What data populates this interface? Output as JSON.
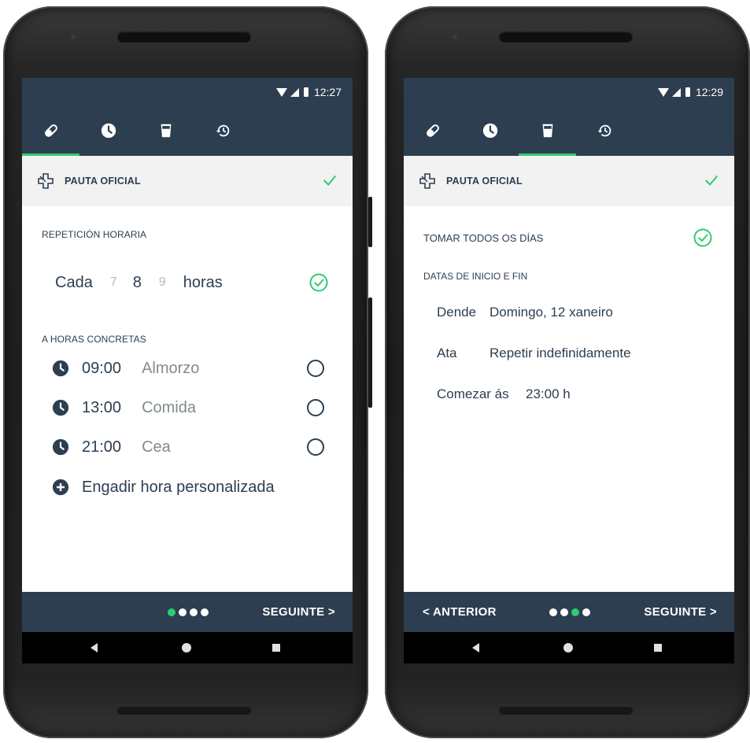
{
  "colors": {
    "primary": "#2c3e50",
    "accent": "#2ecc71",
    "muted": "#7f8c8d",
    "dim": "#b8b8b8",
    "panel": "#f2f2f2"
  },
  "screen1": {
    "status": {
      "time": "12:27"
    },
    "tabs": [
      {
        "icon": "pill-icon",
        "active": true
      },
      {
        "icon": "clock-icon",
        "active": false
      },
      {
        "icon": "glass-icon",
        "active": false
      },
      {
        "icon": "history-icon",
        "active": false
      }
    ],
    "pauta": {
      "label": "PAUTA OFICIAL",
      "icon": "medical-cross-icon",
      "checked": true
    },
    "repeticion": {
      "title": "REPETICIÓN HORARIA",
      "prefix": "Cada",
      "prev": "7",
      "value": "8",
      "next": "9",
      "suffix": "horas",
      "selected": true
    },
    "concretas": {
      "title": "A HORAS CONCRETAS",
      "items": [
        {
          "time": "09:00",
          "label": "Almorzo",
          "selected": false
        },
        {
          "time": "13:00",
          "label": "Comida",
          "selected": false
        },
        {
          "time": "21:00",
          "label": "Cea",
          "selected": false
        }
      ],
      "add_label": "Engadir hora personalizada"
    },
    "nav": {
      "next": "SEGUINTE >",
      "page_index": 0,
      "page_count": 4
    }
  },
  "screen2": {
    "status": {
      "time": "12:29"
    },
    "tabs": [
      {
        "icon": "pill-icon",
        "active": false
      },
      {
        "icon": "clock-icon",
        "active": false
      },
      {
        "icon": "glass-icon",
        "active": true
      },
      {
        "icon": "history-icon",
        "active": false
      }
    ],
    "pauta": {
      "label": "PAUTA OFICIAL",
      "icon": "medical-cross-icon",
      "checked": true
    },
    "tomar": {
      "label": "TOMAR TODOS OS DÍAS",
      "selected": true
    },
    "datas": {
      "title": "DATAS DE INICIO E FIN",
      "dende_label": "Dende",
      "dende_value": "Domingo, 12 xaneiro",
      "ata_label": "Ata",
      "ata_value": "Repetir indefinidamente",
      "comezar_label": "Comezar ás",
      "comezar_value": "23:00 h"
    },
    "nav": {
      "prev": "< ANTERIOR",
      "next": "SEGUINTE >",
      "page_index": 2,
      "page_count": 4
    }
  }
}
